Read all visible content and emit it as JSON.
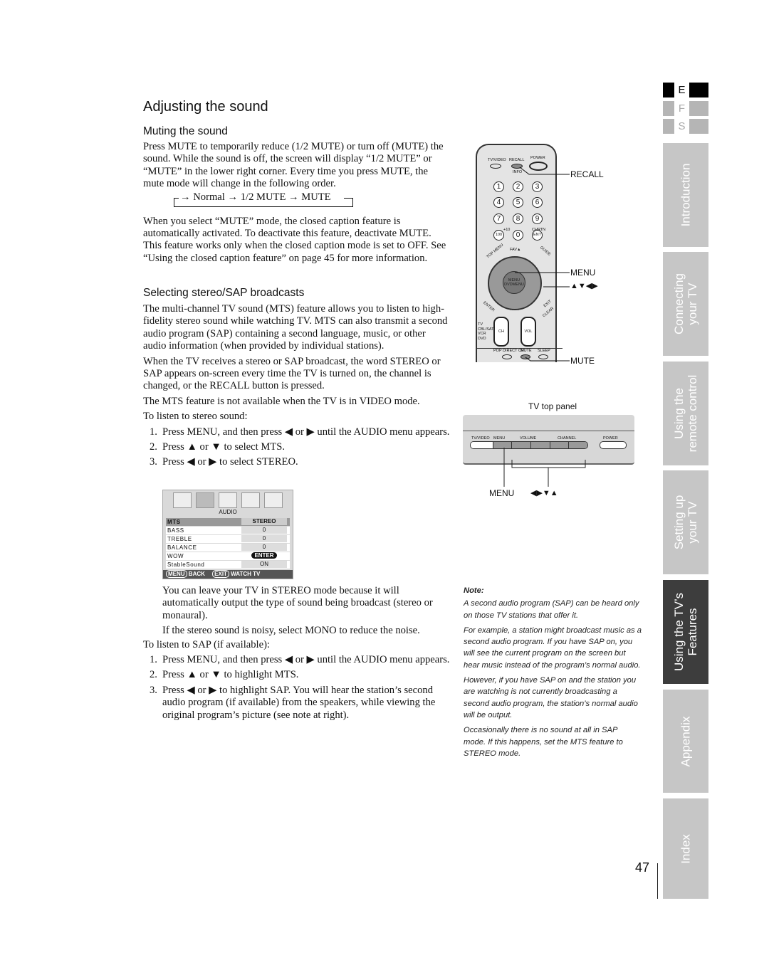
{
  "title": "Adjusting the sound",
  "muting": {
    "heading": "Muting the sound",
    "p1": "Press MUTE to temporarily reduce (1/2 MUTE) or turn off (MUTE) the sound. While the sound is off, the screen will display “1/2 MUTE” or “MUTE” in the lower right corner. Every time you press MUTE, the mute mode will change in the following order.",
    "cycle": "→ Normal → 1/2 MUTE → MUTE",
    "p2": "When you select “MUTE” mode, the closed caption feature is automatically activated. To deactivate this feature, deactivate MUTE. This feature works only when the closed caption mode is set to OFF. See “Using the closed caption feature” on page 45 for more information."
  },
  "sap": {
    "heading": "Selecting stereo/SAP broadcasts",
    "p1": "The multi-channel TV sound (MTS) feature allows you to listen to high-fidelity stereo sound while watching TV. MTS can also transmit a second audio program (SAP) containing a second language, music, or other audio information (when provided by individual stations).",
    "p2": "When the TV receives a stereo or SAP broadcast, the word STEREO or SAP appears on-screen every time the TV is turned on, the channel is changed, or the RECALL button is pressed.",
    "p3": "The MTS feature is not available when the TV is in VIDEO mode.",
    "stereo_intro": "To listen to stereo sound:",
    "stereo_steps": [
      {
        "n": "1.",
        "t": "Press MENU, and then press ◀ or ▶ until the AUDIO menu appears."
      },
      {
        "n": "2.",
        "t": "Press ▲ or ▼ to select MTS."
      },
      {
        "n": "3.",
        "t": "Press ◀ or ▶ to select STEREO."
      }
    ],
    "after1": "You can leave your TV in STEREO mode because it will automatically output the type of sound being broadcast (stereo or monaural).",
    "after2": "If the stereo sound is noisy, select MONO to reduce the noise.",
    "sap_intro": "To listen to SAP (if available):",
    "sap_steps": [
      {
        "n": "1.",
        "t": "Press MENU, and then press ◀ or ▶ until the AUDIO menu appears."
      },
      {
        "n": "2.",
        "t": "Press ▲ or ▼ to highlight MTS."
      },
      {
        "n": "3.",
        "t": "Press ◀ or ▶ to highlight SAP. You will hear the station’s second audio program (if available) from the speakers, while viewing the original program’s picture (see note at right)."
      }
    ]
  },
  "audio_menu": {
    "icons": [
      "picture-icon",
      "audio-icon",
      "setup-icon",
      "clock-icon",
      "wrench-icon"
    ],
    "title": "AUDIO",
    "rows": [
      {
        "label": "MTS",
        "value": "STEREO"
      },
      {
        "label": "BASS",
        "value": "0"
      },
      {
        "label": "TREBLE",
        "value": "0"
      },
      {
        "label": "BALANCE",
        "value": "0"
      },
      {
        "label": "WOW",
        "value": "ENTER"
      },
      {
        "label": "StableSound",
        "value": "ON"
      }
    ],
    "footer": {
      "menu_key": "MENU",
      "back": "BACK",
      "exit_key": "EXIT",
      "watch": "WATCH TV"
    }
  },
  "remote": {
    "top_labels": [
      "TV/VIDEO",
      "RECALL",
      "POWER",
      "INFO"
    ],
    "digits": [
      "1",
      "2",
      "3",
      "4",
      "5",
      "6",
      "7",
      "8",
      "9",
      "100",
      "0",
      "ENT"
    ],
    "plus10": "+10",
    "chrtn": "CHRTN",
    "labels": {
      "fav_up": "FAV▲",
      "fav_down": "FAV▼",
      "menu": "MENU",
      "dvdmenu": "DVDMENU",
      "ch": "CH",
      "vol": "VOL",
      "modes": [
        "TV",
        "CBL/SAT",
        "VCR",
        "DVD"
      ],
      "bottom": [
        "POP DIRECT CH",
        "MUTE",
        "SLEEP"
      ],
      "top_menu": "TOP MENU",
      "guide": "GUIDE",
      "enter": "ENTER",
      "exit": "EXIT",
      "clear": "CLEAR"
    },
    "callouts": {
      "recall": "RECALL",
      "menu": "MENU",
      "arrows": "▲▼◀▶",
      "mute": "MUTE"
    }
  },
  "tv_panel": {
    "caption": "TV top panel",
    "labels": [
      "TV/VIDEO",
      "MENU",
      "VOLUME",
      "CHANNEL",
      "POWER"
    ],
    "callout_menu": "MENU",
    "callout_arrows": "◀▶▼▲"
  },
  "note": {
    "heading": "Note:",
    "paras": [
      "A second audio program (SAP) can be heard only on those TV stations that offer it.",
      "For example, a station might broadcast music as a second audio program. If you have SAP on, you will see the current program on the screen but hear music instead of the program’s normal audio.",
      "However, if you have SAP on and the station you are watching is not currently broadcasting a second audio program, the station’s normal audio will be output.",
      "Occasionally there is no sound at all in SAP mode. If this happens, set the MTS feature to STEREO mode."
    ]
  },
  "languages": [
    {
      "code": "E",
      "active": true
    },
    {
      "code": "F",
      "active": false
    },
    {
      "code": "S",
      "active": false
    }
  ],
  "tabs": [
    {
      "label": "Introduction",
      "active": false
    },
    {
      "label": "Connecting\nyour TV",
      "active": false
    },
    {
      "label": "Using the\nremote control",
      "active": false
    },
    {
      "label": "Setting up\nyour TV",
      "active": false
    },
    {
      "label": "Using the TV’s\nFeatures",
      "active": true
    },
    {
      "label": "Appendix",
      "active": false
    },
    {
      "label": "Index",
      "active": false
    }
  ],
  "page_number": "47"
}
